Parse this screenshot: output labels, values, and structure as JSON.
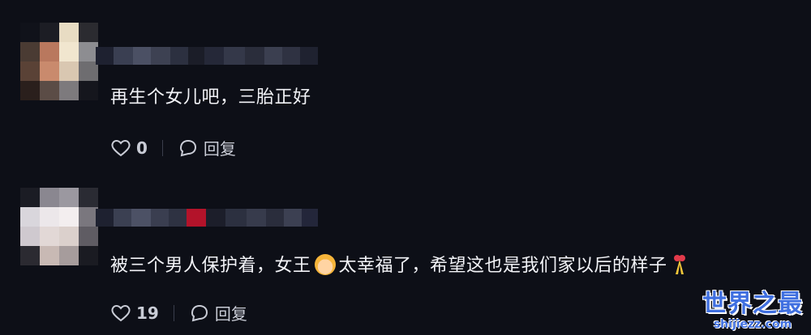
{
  "comments": [
    {
      "text": "再生个女儿吧，三胎正好",
      "likes": "0",
      "reply_label": "回复"
    },
    {
      "text_before": "被三个男人保护着，女王",
      "emoji1": "woman-crown-face-emoji",
      "text_after": "太幸福了，希望这也是我们家以后的样子",
      "emoji2": "ribbon-emoji",
      "likes": "19",
      "reply_label": "回复"
    }
  ],
  "watermark": {
    "title": "世界之最",
    "url": "shijiezz.com"
  },
  "colors": {
    "background": "#0d0f17",
    "text": "#f2f3f7",
    "muted": "#c9ccd6",
    "watermark": "#3f6fe0"
  },
  "icons": {
    "like": "heart-outline-icon",
    "reply": "speech-bubble-icon"
  }
}
